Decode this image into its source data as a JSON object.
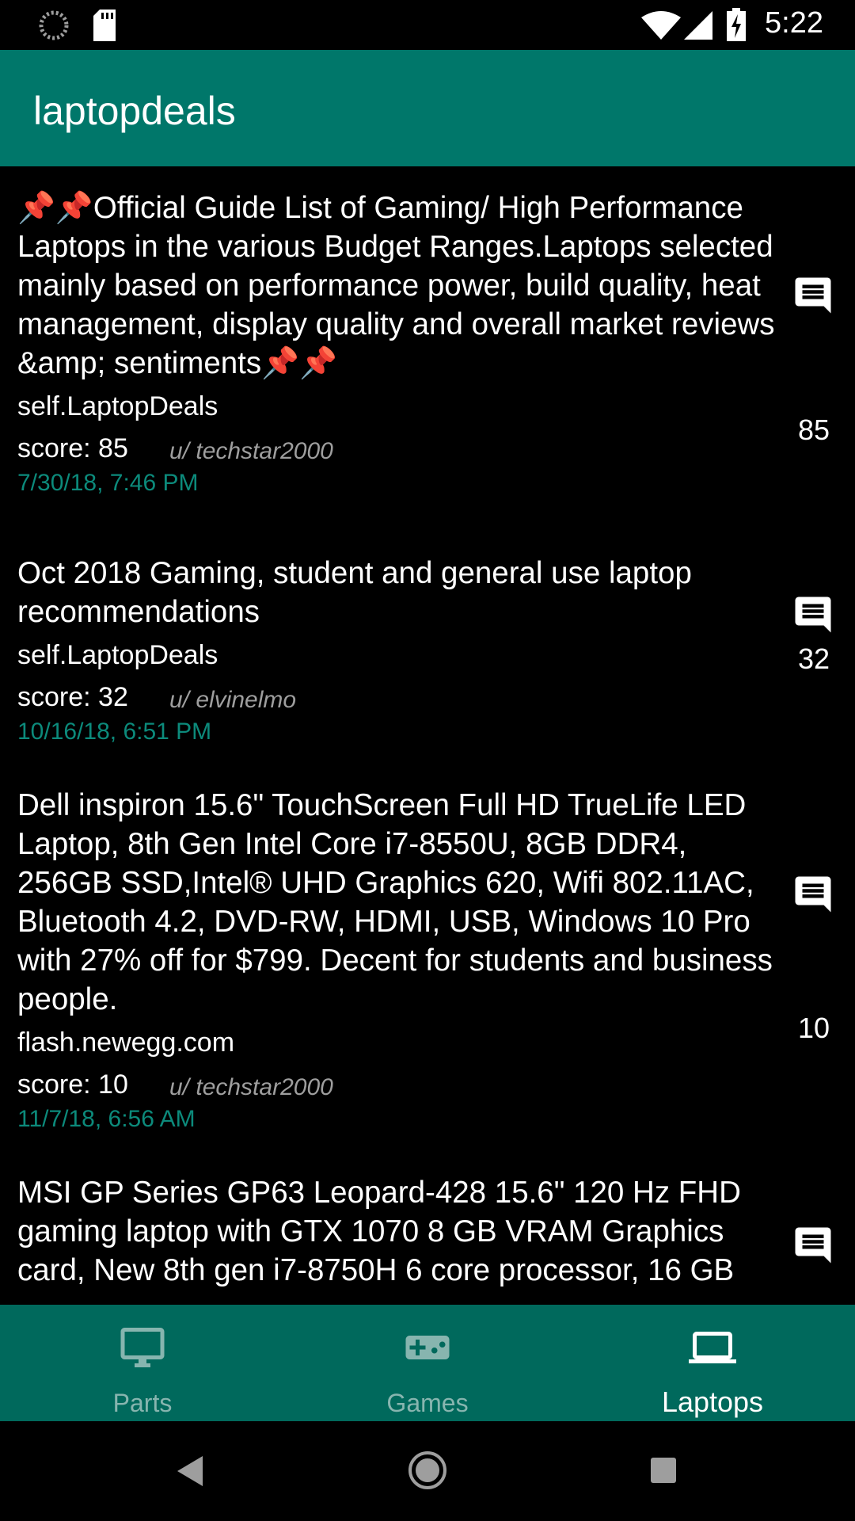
{
  "status_bar": {
    "time": "5:22",
    "icons": [
      "loading-spinner-icon",
      "sd-card-icon",
      "wifi-icon",
      "signal-icon",
      "battery-charging-icon"
    ]
  },
  "app_bar": {
    "title": "laptopdeals"
  },
  "posts": [
    {
      "title": "📌📌Official Guide List of Gaming/ High Performance Laptops in the various Budget Ranges.Laptops selected mainly based on performance power, build quality, heat management, display quality and overall market reviews &amp; sentiments📌📌",
      "domain": "self.LaptopDeals",
      "score": "score: 85",
      "author": "u/ techstar2000",
      "date": "7/30/18, 7:46 PM",
      "comments": "85"
    },
    {
      "title": "Oct 2018 Gaming, student and general use laptop recommendations",
      "domain": "self.LaptopDeals",
      "score": "score: 32",
      "author": "u/ elvinelmo",
      "date": "10/16/18, 6:51 PM",
      "comments": "32"
    },
    {
      "title": "Dell inspiron 15.6\" TouchScreen Full HD TrueLife LED Laptop, 8th Gen Intel Core i7-8550U, 8GB DDR4, 256GB SSD,Intel® UHD Graphics 620, Wifi 802.11AC, Bluetooth 4.2, DVD-RW, HDMI, USB, Windows 10 Pro with 27% off for $799. Decent for students and business people.",
      "domain": "flash.newegg.com",
      "score": "score: 10",
      "author": "u/ techstar2000",
      "date": "11/7/18, 6:56 AM",
      "comments": "10"
    },
    {
      "title": "MSI GP Series GP63 Leopard-428 15.6\" 120 Hz FHD gaming laptop with GTX 1070 8 GB VRAM Graphics card, New 8th gen i7-8750H 6 core processor, 16 GB"
    }
  ],
  "bottom_nav": {
    "items": [
      {
        "label": "Parts",
        "icon": "monitor-icon",
        "active": false
      },
      {
        "label": "Games",
        "icon": "gamepad-icon",
        "active": false
      },
      {
        "label": "Laptops",
        "icon": "laptop-icon",
        "active": true
      }
    ]
  },
  "colors": {
    "app_bar": "#00776a",
    "bottom_nav": "#00695c",
    "date_text": "#0c8a7b",
    "author_text": "#9e9e9e"
  }
}
